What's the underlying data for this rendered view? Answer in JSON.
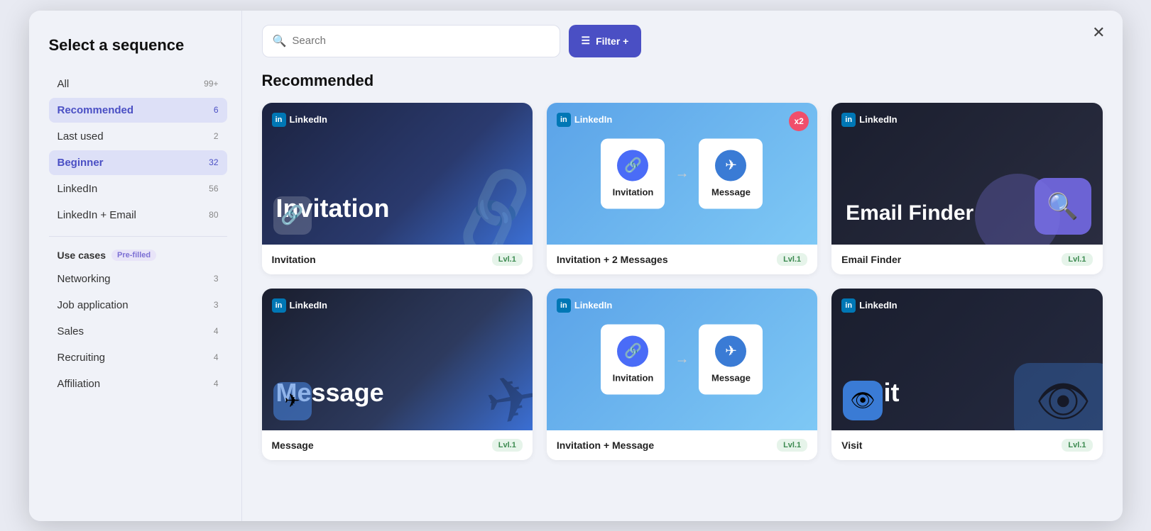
{
  "modal": {
    "title": "Select a sequence"
  },
  "sidebar": {
    "title": "Select a sequence",
    "items": [
      {
        "label": "All",
        "badge": "99+",
        "active": false
      },
      {
        "label": "Recommended",
        "badge": "6",
        "active": true
      },
      {
        "label": "Last used",
        "badge": "2",
        "active": false
      },
      {
        "label": "Beginner",
        "badge": "32",
        "active": true
      },
      {
        "label": "LinkedIn",
        "badge": "56",
        "active": false
      },
      {
        "label": "LinkedIn + Email",
        "badge": "80",
        "active": false
      }
    ],
    "use_cases_label": "Use cases",
    "pre_filled_label": "Pre-filled",
    "use_case_items": [
      {
        "label": "Networking",
        "badge": "3"
      },
      {
        "label": "Job application",
        "badge": "3"
      },
      {
        "label": "Sales",
        "badge": "4"
      },
      {
        "label": "Recruiting",
        "badge": "4"
      },
      {
        "label": "Affiliation",
        "badge": "4"
      }
    ]
  },
  "search": {
    "placeholder": "Search"
  },
  "filter": {
    "label": "Filter +"
  },
  "main": {
    "section_title": "Recommended",
    "cards": [
      {
        "id": "invitation",
        "title": "Invitation",
        "level": "Lvl.1",
        "type": "dark-blue",
        "big_text": "Invitation",
        "linkedin_label": "LinkedIn"
      },
      {
        "id": "invitation-2-messages",
        "title": "Invitation + 2 Messages",
        "level": "Lvl.1",
        "type": "blue-multi",
        "linkedin_label": "LinkedIn",
        "step1": "Invitation",
        "step2": "Message",
        "x2": "x2"
      },
      {
        "id": "email-finder",
        "title": "Email Finder",
        "level": "Lvl.1",
        "type": "dark",
        "big_text": "Email Finder",
        "linkedin_label": "LinkedIn"
      },
      {
        "id": "message",
        "title": "Message",
        "level": "Lvl.1",
        "type": "dark-blue2",
        "big_text": "Message",
        "linkedin_label": "LinkedIn"
      },
      {
        "id": "invitation-message",
        "title": "Invitation + Message",
        "level": "Lvl.1",
        "type": "blue-multi2",
        "linkedin_label": "LinkedIn",
        "step1": "Invitation",
        "step2": "Message"
      },
      {
        "id": "visit",
        "title": "Visit",
        "level": "Lvl.1",
        "type": "dark2",
        "big_text": "Visit",
        "linkedin_label": "LinkedIn"
      }
    ]
  }
}
